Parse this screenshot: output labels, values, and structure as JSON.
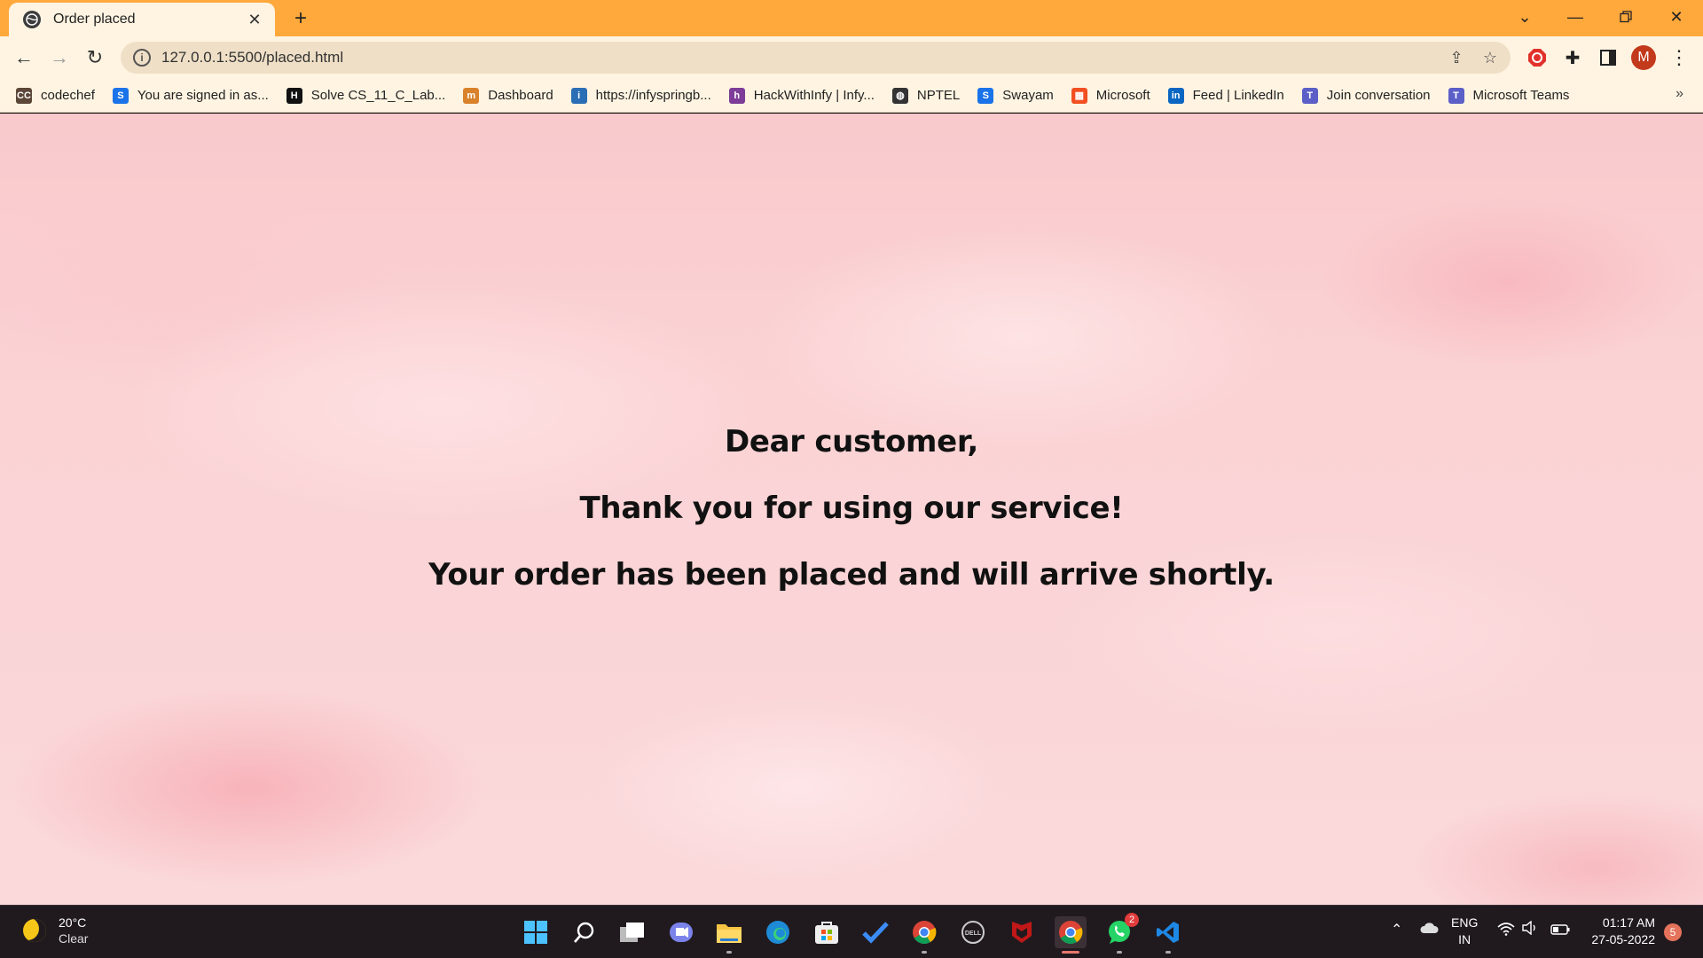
{
  "browser": {
    "tab_title": "Order placed",
    "url": "127.0.0.1:5500/placed.html",
    "profile_initial": "M"
  },
  "bookmarks": [
    {
      "label": "codechef",
      "icon": "codechef-icon",
      "color": "#5b4638",
      "glyph": "CC"
    },
    {
      "label": "You are signed in as...",
      "icon": "swayam-s-icon",
      "color": "#1a73e8",
      "glyph": "S"
    },
    {
      "label": "Solve CS_11_C_Lab...",
      "icon": "hackerrank-icon",
      "color": "#111111",
      "glyph": "H"
    },
    {
      "label": "Dashboard",
      "icon": "dashboard-icon",
      "color": "#d9822b",
      "glyph": "m"
    },
    {
      "label": "https://infyspringb...",
      "icon": "infy-icon",
      "color": "#2a6fb5",
      "glyph": "i"
    },
    {
      "label": "HackWithInfy | Infy...",
      "icon": "hackwithinfy-icon",
      "color": "#7d3c98",
      "glyph": "h"
    },
    {
      "label": "NPTEL",
      "icon": "globe-icon",
      "color": "#333333",
      "glyph": "◍"
    },
    {
      "label": "Swayam",
      "icon": "swayam-icon",
      "color": "#1a73e8",
      "glyph": "S"
    },
    {
      "label": "Microsoft",
      "icon": "microsoft-icon",
      "color": "#f25022",
      "glyph": "▦"
    },
    {
      "label": "Feed | LinkedIn",
      "icon": "linkedin-icon",
      "color": "#0a66c2",
      "glyph": "in"
    },
    {
      "label": "Join conversation",
      "icon": "teams-icon",
      "color": "#5b5fc7",
      "glyph": "T"
    },
    {
      "label": "Microsoft Teams",
      "icon": "teams-icon",
      "color": "#5b5fc7",
      "glyph": "T"
    }
  ],
  "content": {
    "line1": "Dear customer,",
    "line2": "Thank you for using our service!",
    "line3": "Your order has been placed and will arrive shortly."
  },
  "taskbar": {
    "weather_temp": "20°C",
    "weather_cond": "Clear",
    "apps": [
      {
        "name": "start-icon"
      },
      {
        "name": "search-icon"
      },
      {
        "name": "task-view-icon"
      },
      {
        "name": "teams-chat-icon"
      },
      {
        "name": "file-explorer-icon"
      },
      {
        "name": "edge-icon"
      },
      {
        "name": "store-icon"
      },
      {
        "name": "todo-icon"
      },
      {
        "name": "chrome-icon"
      },
      {
        "name": "dell-icon"
      },
      {
        "name": "mcafee-icon"
      },
      {
        "name": "chrome-profile-icon"
      },
      {
        "name": "whatsapp-icon",
        "badge": "2"
      },
      {
        "name": "vscode-icon"
      }
    ],
    "lang_top": "ENG",
    "lang_bottom": "IN",
    "time": "01:17 AM",
    "date": "27-05-2022",
    "notifications": "5"
  },
  "colors": {
    "title_bar": "#ffa83c",
    "toolbar": "#fff4e2",
    "page_background": "#fad4d6",
    "taskbar": "#201a1f"
  }
}
